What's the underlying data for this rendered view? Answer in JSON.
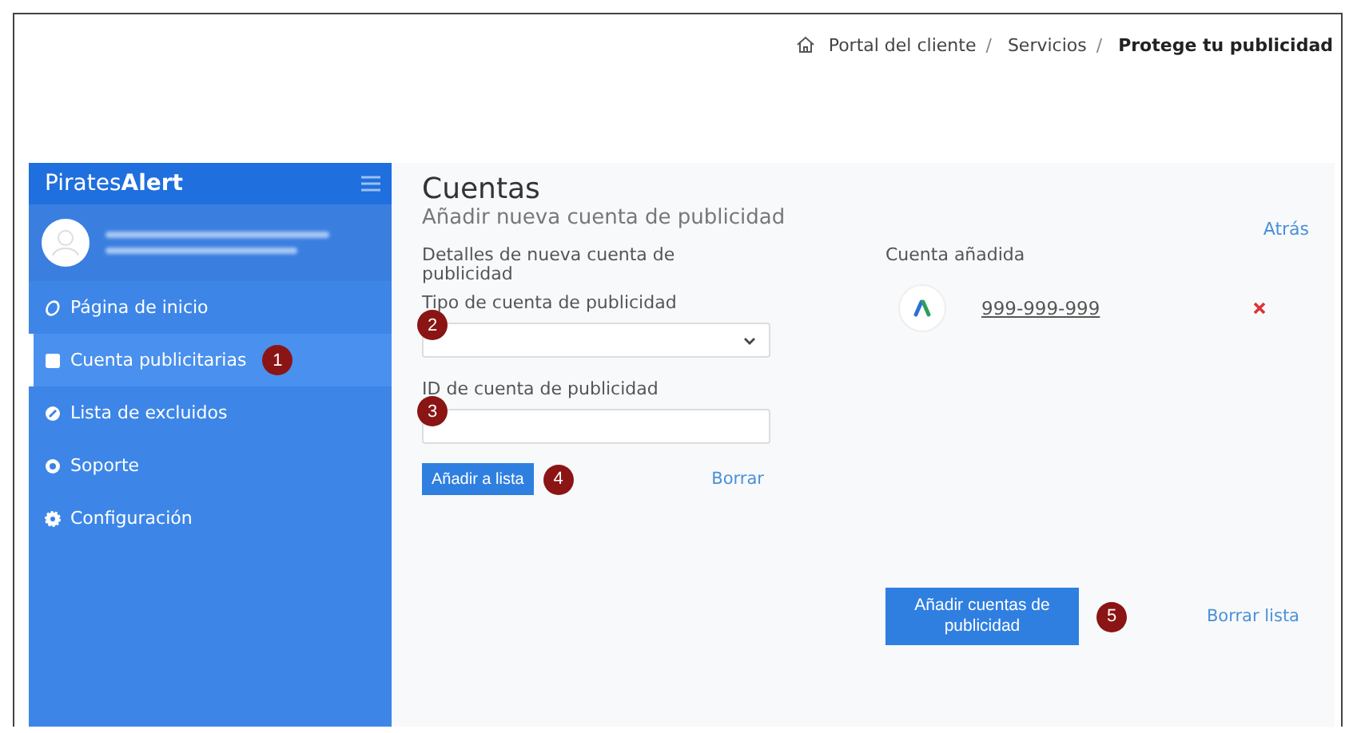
{
  "breadcrumb": [
    {
      "label": "Portal del cliente",
      "current": false,
      "separator": "/"
    },
    {
      "label": "Servicios",
      "current": false,
      "separator": "/"
    },
    {
      "label": "Protege tu publicidad",
      "current": true
    }
  ],
  "sidebar": {
    "brand_regular": "Pirates",
    "brand_bold": "Alert",
    "items": [
      {
        "label": "Página de inicio",
        "selected": false
      },
      {
        "label": "Cuenta publicitarias",
        "selected": true,
        "callout": "1"
      },
      {
        "label": "Lista de excluidos",
        "selected": false
      },
      {
        "label": "Soporte",
        "selected": false
      },
      {
        "label": "Configuración",
        "selected": false
      }
    ]
  },
  "main": {
    "title": "Cuentas",
    "subtitle": "Añadir nueva cuenta de publicidad",
    "back_link": "Atrás",
    "form": {
      "heading": "Detalles de nueva cuenta de publicidad",
      "type_label": "Tipo de cuenta de publicidad",
      "type_callout": "2",
      "id_label": "ID de cuenta de publicidad",
      "id_callout": "3",
      "add_button": "Añadir a lista",
      "add_callout": "4",
      "clear_link": "Borrar"
    },
    "added": {
      "heading": "Cuenta añadida",
      "accounts": [
        {
          "id": "999-999-999"
        }
      ]
    },
    "submit_button": "Añadir cuentas de publicidad",
    "submit_callout": "5",
    "clear_list_link": "Borrar lista"
  }
}
